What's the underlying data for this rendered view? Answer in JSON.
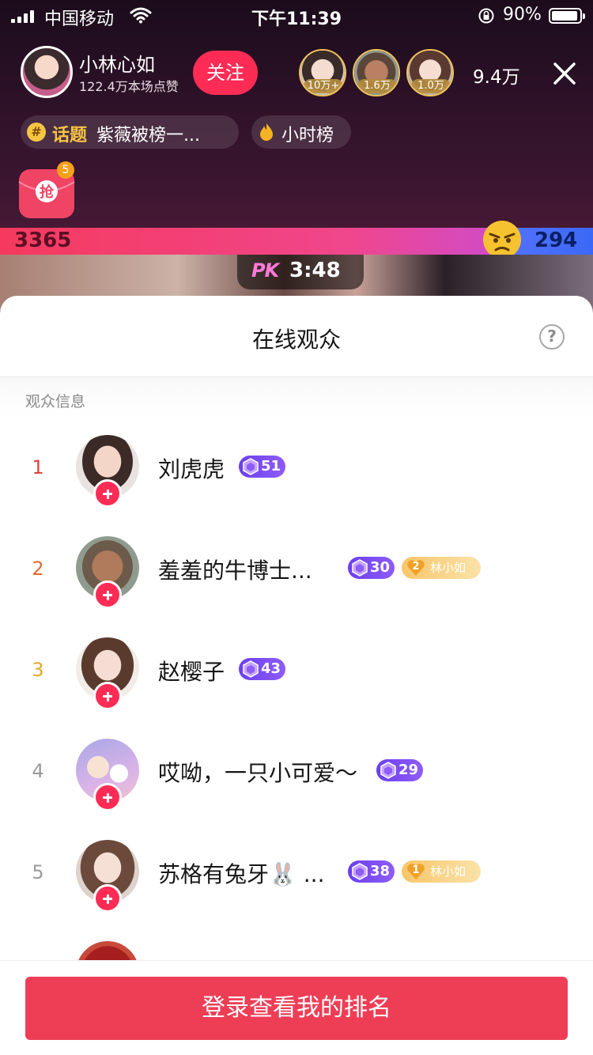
{
  "status_bar": {
    "carrier": "中国移动",
    "time": "下午11:39",
    "battery": "90%"
  },
  "host": {
    "name": "小林心如",
    "likes": "122.4万本场点赞",
    "follow_label": "关注"
  },
  "top_fans": [
    {
      "tag": "10万+"
    },
    {
      "tag": "1.6万"
    },
    {
      "tag": "1.0万"
    }
  ],
  "viewer_count": "9.4万",
  "topic": {
    "label": "话题",
    "text": "紫薇被榜一...",
    "hash": "#"
  },
  "hour_rank": "小时榜",
  "redpacket_count": "5",
  "pk": {
    "left_score": "3365",
    "right_score": "294",
    "logo": "PK",
    "timer": "3:48"
  },
  "sheet": {
    "title": "在线观众",
    "help": "?",
    "section_label": "观众信息"
  },
  "audience": [
    {
      "rank": "1",
      "name": "刘虎虎",
      "level": "51",
      "fan_level": null,
      "fan_name": null,
      "rank_color": "#e0423f"
    },
    {
      "rank": "2",
      "name": "羞羞的牛博士...",
      "level": "30",
      "fan_level": "2",
      "fan_name": "林小如",
      "rank_color": "#e86a2f"
    },
    {
      "rank": "3",
      "name": "赵樱子",
      "level": "43",
      "fan_level": null,
      "fan_name": null,
      "rank_color": "#e1a92c"
    },
    {
      "rank": "4",
      "name": "哎呦，一只小可爱～",
      "level": "29",
      "fan_level": null,
      "fan_name": null,
      "rank_color": "#9b9b9b"
    },
    {
      "rank": "5",
      "name": "苏格有兔牙🐰 ...",
      "level": "38",
      "fan_level": "1",
      "fan_name": "林小如",
      "rank_color": "#9b9b9b"
    }
  ],
  "login_button": "登录查看我的排名",
  "colors": {
    "accent": "#fe2c55",
    "login": "#ee3e56",
    "level_badge": "#7a4af3",
    "fan_badge": "#f7c66a"
  }
}
